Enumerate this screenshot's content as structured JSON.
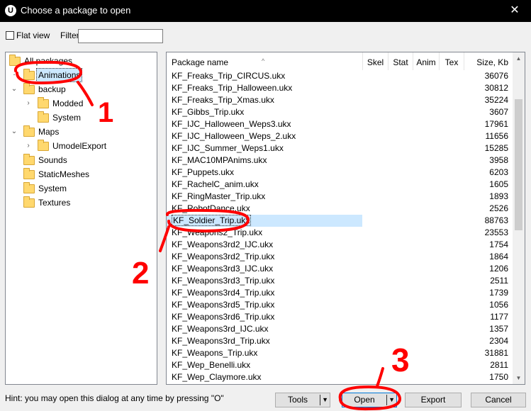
{
  "window": {
    "title": "Choose a package to open",
    "close_glyph": "✕",
    "app_icon_glyph": "U"
  },
  "toolbar": {
    "flat_view_label": "Flat view",
    "flat_view_checked": false,
    "filter_label": "Filter:",
    "filter_value": ""
  },
  "tree": {
    "items": [
      {
        "label": "All packages",
        "expander": "",
        "selected": false
      },
      {
        "label": "Animations",
        "expander": "",
        "selected": true
      },
      {
        "label": "backup",
        "expander": "⌄",
        "selected": false
      },
      {
        "label": "Modded",
        "expander": "›",
        "selected": false
      },
      {
        "label": "System",
        "expander": "",
        "selected": false
      },
      {
        "label": "Maps",
        "expander": "⌄",
        "selected": false
      },
      {
        "label": "UmodelExport",
        "expander": "›",
        "selected": false
      },
      {
        "label": "Sounds",
        "expander": "",
        "selected": false
      },
      {
        "label": "StaticMeshes",
        "expander": "",
        "selected": false
      },
      {
        "label": "System",
        "expander": "",
        "selected": false
      },
      {
        "label": "Textures",
        "expander": "",
        "selected": false
      }
    ]
  },
  "list": {
    "columns": {
      "name": "Package name",
      "skel": "Skel",
      "stat": "Stat",
      "anim": "Anim",
      "tex": "Tex",
      "size": "Size, Kb"
    },
    "sort_glyph": "^",
    "rows": [
      {
        "name": "KF_Freaks_Trip_CIRCUS.ukx",
        "size": "36076"
      },
      {
        "name": "KF_Freaks_Trip_Halloween.ukx",
        "size": "30812"
      },
      {
        "name": "KF_Freaks_Trip_Xmas.ukx",
        "size": "35224"
      },
      {
        "name": "KF_Gibbs_Trip.ukx",
        "size": "3607"
      },
      {
        "name": "KF_IJC_Halloween_Weps3.ukx",
        "size": "17961"
      },
      {
        "name": "KF_IJC_Halloween_Weps_2.ukx",
        "size": "11656"
      },
      {
        "name": "KF_IJC_Summer_Weps1.ukx",
        "size": "15285"
      },
      {
        "name": "KF_MAC10MPAnims.ukx",
        "size": "3958"
      },
      {
        "name": "KF_Puppets.ukx",
        "size": "6203"
      },
      {
        "name": "KF_RachelC_anim.ukx",
        "size": "1605"
      },
      {
        "name": "KF_RingMaster_Trip.ukx",
        "size": "1893"
      },
      {
        "name": "KF_RobotDance.ukx",
        "size": "2526"
      },
      {
        "name": "KF_Soldier_Trip.ukx",
        "size": "88763"
      },
      {
        "name": "KF_Weapons2_Trip.ukx",
        "size": "23553"
      },
      {
        "name": "KF_Weapons3rd2_IJC.ukx",
        "size": "1754"
      },
      {
        "name": "KF_Weapons3rd2_Trip.ukx",
        "size": "1864"
      },
      {
        "name": "KF_Weapons3rd3_IJC.ukx",
        "size": "1206"
      },
      {
        "name": "KF_Weapons3rd3_Trip.ukx",
        "size": "2511"
      },
      {
        "name": "KF_Weapons3rd4_Trip.ukx",
        "size": "1739"
      },
      {
        "name": "KF_Weapons3rd5_Trip.ukx",
        "size": "1056"
      },
      {
        "name": "KF_Weapons3rd6_Trip.ukx",
        "size": "1177"
      },
      {
        "name": "KF_Weapons3rd_IJC.ukx",
        "size": "1357"
      },
      {
        "name": "KF_Weapons3rd_Trip.ukx",
        "size": "2304"
      },
      {
        "name": "KF_Weapons_Trip.ukx",
        "size": "31881"
      },
      {
        "name": "KF_Wep_Benelli.ukx",
        "size": "2811"
      },
      {
        "name": "KF_Wep_Claymore.ukx",
        "size": "1750"
      }
    ],
    "selected_index": 12,
    "scroll_up_glyph": "▲",
    "scroll_down_glyph": "▼"
  },
  "footer": {
    "hint": "Hint: you may open this dialog at any time by pressing \"O\"",
    "tools_label": "Tools",
    "open_label": "Open",
    "export_label": "Export",
    "cancel_label": "Cancel",
    "dropdown_glyph": "▼"
  },
  "annotations": {
    "color": "#ff0000",
    "labels": [
      "1",
      "2",
      "3"
    ]
  }
}
